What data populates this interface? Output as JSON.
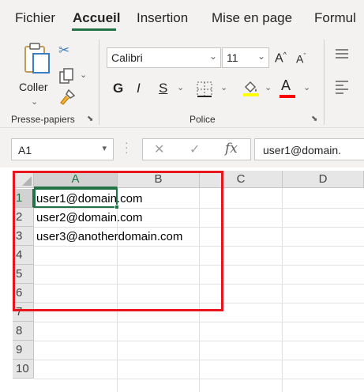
{
  "tabs": [
    "Fichier",
    "Accueil",
    "Insertion",
    "Mise en page",
    "Formul"
  ],
  "active_tab": "Accueil",
  "clipboard": {
    "paste_label": "Coller",
    "group_label": "Presse-papiers"
  },
  "font": {
    "name": "Calibri",
    "size": "11",
    "bold": "G",
    "italic": "I",
    "underline": "S",
    "grow": "A",
    "shrink": "A",
    "font_color_letter": "A",
    "group_label": "Police"
  },
  "formula_bar": {
    "name_box": "A1",
    "fx": "fx",
    "content": "user1@domain."
  },
  "columns": [
    "A",
    "B",
    "C",
    "D"
  ],
  "rows": [
    "1",
    "2",
    "3",
    "4",
    "5",
    "6",
    "7",
    "8",
    "9",
    "10"
  ],
  "cells": {
    "A1": "user1@domain.com",
    "A2": "user2@domain.com",
    "A3": "user3@anotherdomain.com"
  },
  "colors": {
    "accent": "#217346",
    "highlight_border": "#e8151c",
    "fill_yellow": "#ffff00",
    "font_red": "#ff0000"
  }
}
